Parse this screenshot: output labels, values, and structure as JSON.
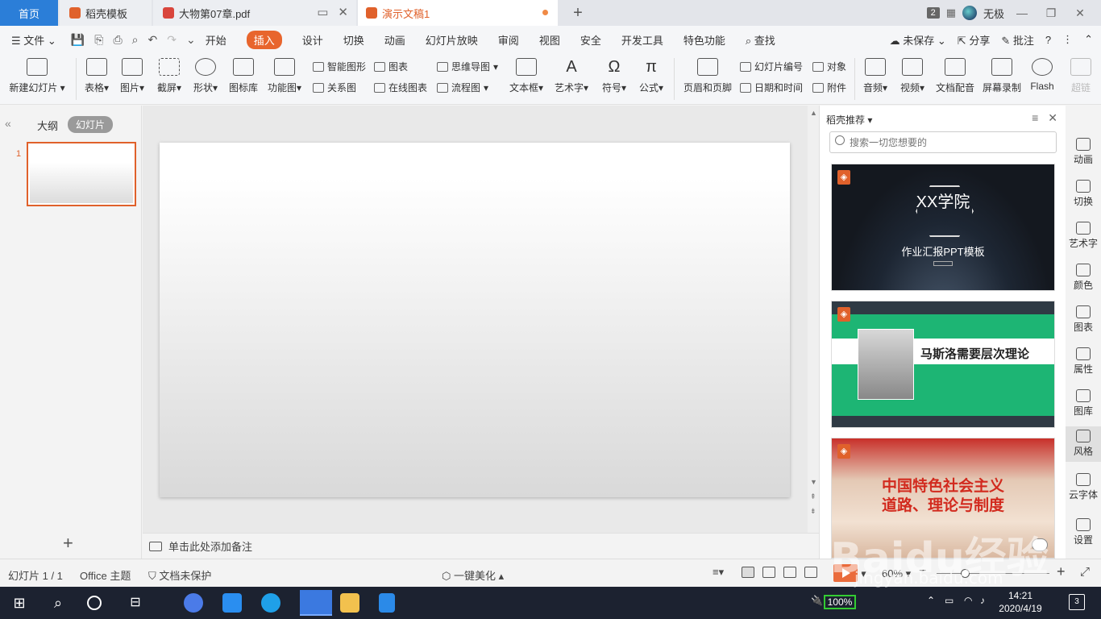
{
  "tabs": {
    "home": "首页",
    "daoke": "稻壳模板",
    "pdf": "大物第07章.pdf",
    "presentation": "演示文稿1"
  },
  "titlebar": {
    "badge": "2",
    "user": "无极"
  },
  "menu": {
    "file": "文件",
    "items": [
      "开始",
      "插入",
      "设计",
      "切换",
      "动画",
      "幻灯片放映",
      "审阅",
      "视图",
      "安全",
      "开发工具",
      "特色功能"
    ],
    "active": "插入",
    "search": "查找",
    "unsaved": "未保存",
    "share": "分享",
    "comment": "批注"
  },
  "ribbon": {
    "new_slide": "新建幻灯片",
    "table": "表格",
    "picture": "图片",
    "screenshot": "截屏",
    "shape": "形状",
    "icon_lib": "图标库",
    "func_chart": "功能图",
    "smart_shape": "智能图形",
    "chart": "图表",
    "relation": "关系图",
    "online_chart": "在线图表",
    "mindmap": "思维导图",
    "flowchart": "流程图",
    "textbox": "文本框",
    "wordart": "艺术字",
    "symbol": "符号",
    "formula": "公式",
    "header_footer": "页眉和页脚",
    "slide_number": "幻灯片编号",
    "object": "对象",
    "datetime": "日期和时间",
    "attachment": "附件",
    "audio": "音频",
    "video": "视频",
    "doc_dubbing": "文档配音",
    "screen_record": "屏幕录制",
    "flash": "Flash",
    "hyperlink": "超链"
  },
  "left_panel": {
    "outline": "大纲",
    "slides": "幻灯片",
    "slide_number": "1"
  },
  "notes": {
    "placeholder": "单击此处添加备注"
  },
  "right_panel": {
    "title": "稻壳推荐",
    "search_placeholder": "搜索一切您想要的",
    "card1": {
      "title": "XX学院",
      "subtitle": "作业汇报PPT模板"
    },
    "card2": {
      "title": "马斯洛需要层次理论"
    },
    "card3": {
      "line1": "中国特色社会主义",
      "line2": "道路、理论与制度"
    }
  },
  "sidebar": [
    "动画",
    "切换",
    "艺术字",
    "颜色",
    "图表",
    "属性",
    "图库",
    "风格",
    "云字体",
    "设置"
  ],
  "statusbar": {
    "slide_info": "幻灯片 1 / 1",
    "theme": "Office 主题",
    "protect": "文档未保护",
    "beautify": "一键美化",
    "zoom": "60%",
    "zoom_level": 0.25
  },
  "taskbar": {
    "battery": "100%",
    "time": "14:21",
    "date": "2020/4/19",
    "notifications": "3"
  },
  "watermark": {
    "main": "Baidu经验",
    "sub": "jingyan.baidu.com"
  },
  "colors": {
    "accent": "#e0612b",
    "tab_home": "#2b7ed8",
    "green": "#1db574"
  }
}
